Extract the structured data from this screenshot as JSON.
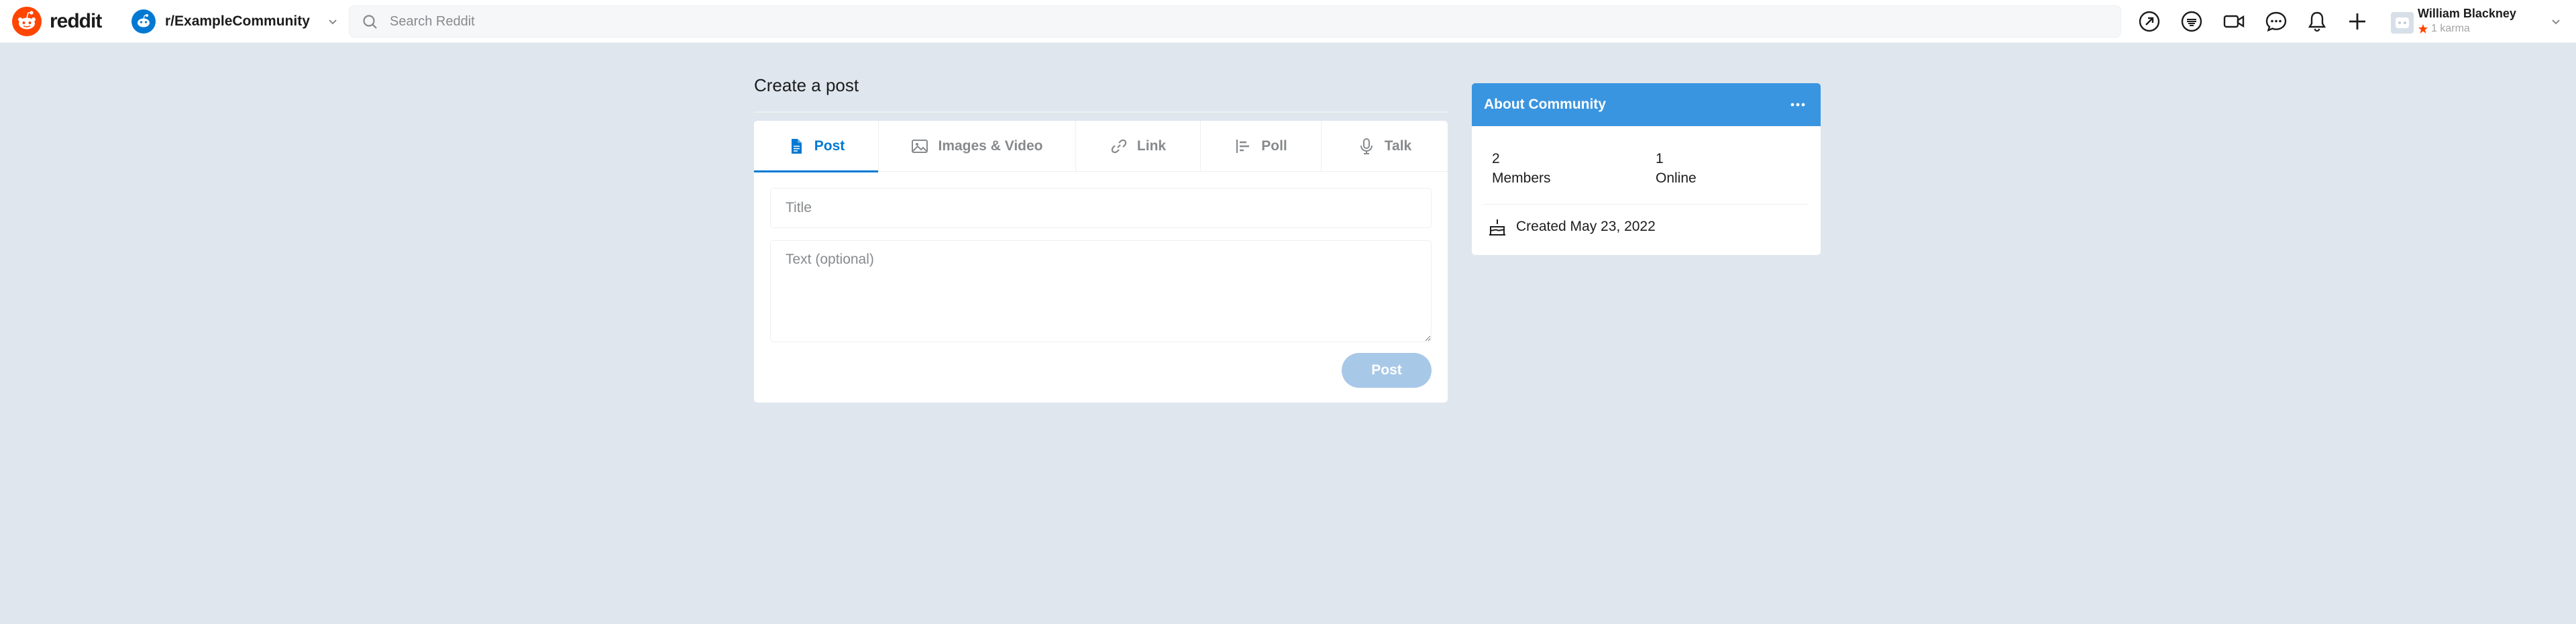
{
  "header": {
    "logo_text": "reddit",
    "community": "r/ExampleCommunity",
    "search_placeholder": "Search Reddit",
    "icons": [
      "popular-icon",
      "coins-icon",
      "video-icon",
      "chat-icon",
      "notification-icon",
      "create-post-icon"
    ],
    "user": {
      "name": "William Blackney",
      "karma": "1 karma"
    }
  },
  "main": {
    "page_title": "Create a post",
    "tabs": [
      {
        "label": "Post",
        "icon": "post-icon",
        "active": true
      },
      {
        "label": "Images & Video",
        "icon": "image-icon",
        "active": false
      },
      {
        "label": "Link",
        "icon": "link-icon",
        "active": false
      },
      {
        "label": "Poll",
        "icon": "poll-icon",
        "active": false
      },
      {
        "label": "Talk",
        "icon": "microphone-icon",
        "active": false
      }
    ],
    "title_value": "",
    "title_placeholder": "Title",
    "body_value": "",
    "body_placeholder": "Text (optional)",
    "post_button": "Post"
  },
  "about": {
    "title": "About Community",
    "members_count": "2",
    "members_label": "Members",
    "online_count": "1",
    "online_label": "Online",
    "created": "Created May 23, 2022"
  },
  "colors": {
    "accent": "#0079d3",
    "about_header": "#3a95e0",
    "reddit_orange": "#ff4500",
    "background": "#dfe6ee",
    "post_button_disabled": "#a8c8e8"
  }
}
